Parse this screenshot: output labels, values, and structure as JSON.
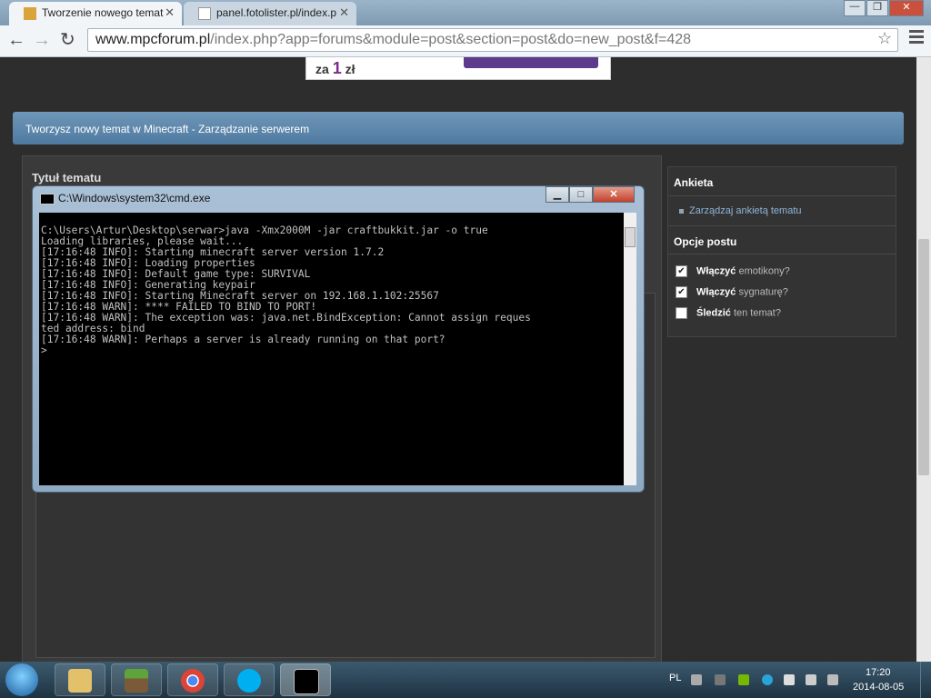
{
  "browser": {
    "tabs": [
      {
        "label": "Tworzenie nowego temat",
        "active": true
      },
      {
        "label": "panel.fotolister.pl/index.p",
        "active": false
      }
    ],
    "url_host": "www.mpcforum.pl",
    "url_path": "/index.php?app=forums&module=post&section=post&do=new_post&f=428",
    "icons": {
      "back": "back-arrow-icon",
      "forward": "forward-arrow-icon",
      "reload": "reload-icon",
      "star": "star-icon",
      "menu": "hamburger-menu-icon"
    }
  },
  "ad": {
    "prefix": "za",
    "number": "1",
    "suffix": "zł"
  },
  "forum": {
    "topic_header": "Tworzysz nowy temat w Minecraft - Zarządzanie serwerem",
    "title_label": "Tytuł tematu",
    "sidebar": {
      "poll_heading": "Ankieta",
      "poll_link": "Zarządzaj ankietą tematu",
      "options_heading": "Opcje postu",
      "options": [
        {
          "bold": "Włączyć",
          "text": " emotikony?",
          "checked": true
        },
        {
          "bold": "Włączyć",
          "text": " sygnaturę?",
          "checked": true
        },
        {
          "bold": "Śledzić",
          "text": " ten temat?",
          "checked": false
        }
      ]
    }
  },
  "cmd": {
    "title": "C:\\Windows\\system32\\cmd.exe",
    "lines": [
      "",
      "C:\\Users\\Artur\\Desktop\\serwar>java -Xmx2000M -jar craftbukkit.jar -o true",
      "Loading libraries, please wait...",
      "[17:16:48 INFO]: Starting minecraft server version 1.7.2",
      "[17:16:48 INFO]: Loading properties",
      "[17:16:48 INFO]: Default game type: SURVIVAL",
      "[17:16:48 INFO]: Generating keypair",
      "[17:16:48 INFO]: Starting Minecraft server on 192.168.1.102:25567",
      "[17:16:48 WARN]: **** FAILED TO BIND TO PORT!",
      "[17:16:48 WARN]: The exception was: java.net.BindException: Cannot assign reques",
      "ted address: bind",
      "[17:16:48 WARN]: Perhaps a server is already running on that port?",
      ">"
    ]
  },
  "taskbar": {
    "language": "PL",
    "time": "17:20",
    "date": "2014-08-05",
    "apps": [
      "windows-explorer-icon",
      "minecraft-icon",
      "chrome-icon",
      "skype-icon",
      "cmd-icon"
    ]
  }
}
